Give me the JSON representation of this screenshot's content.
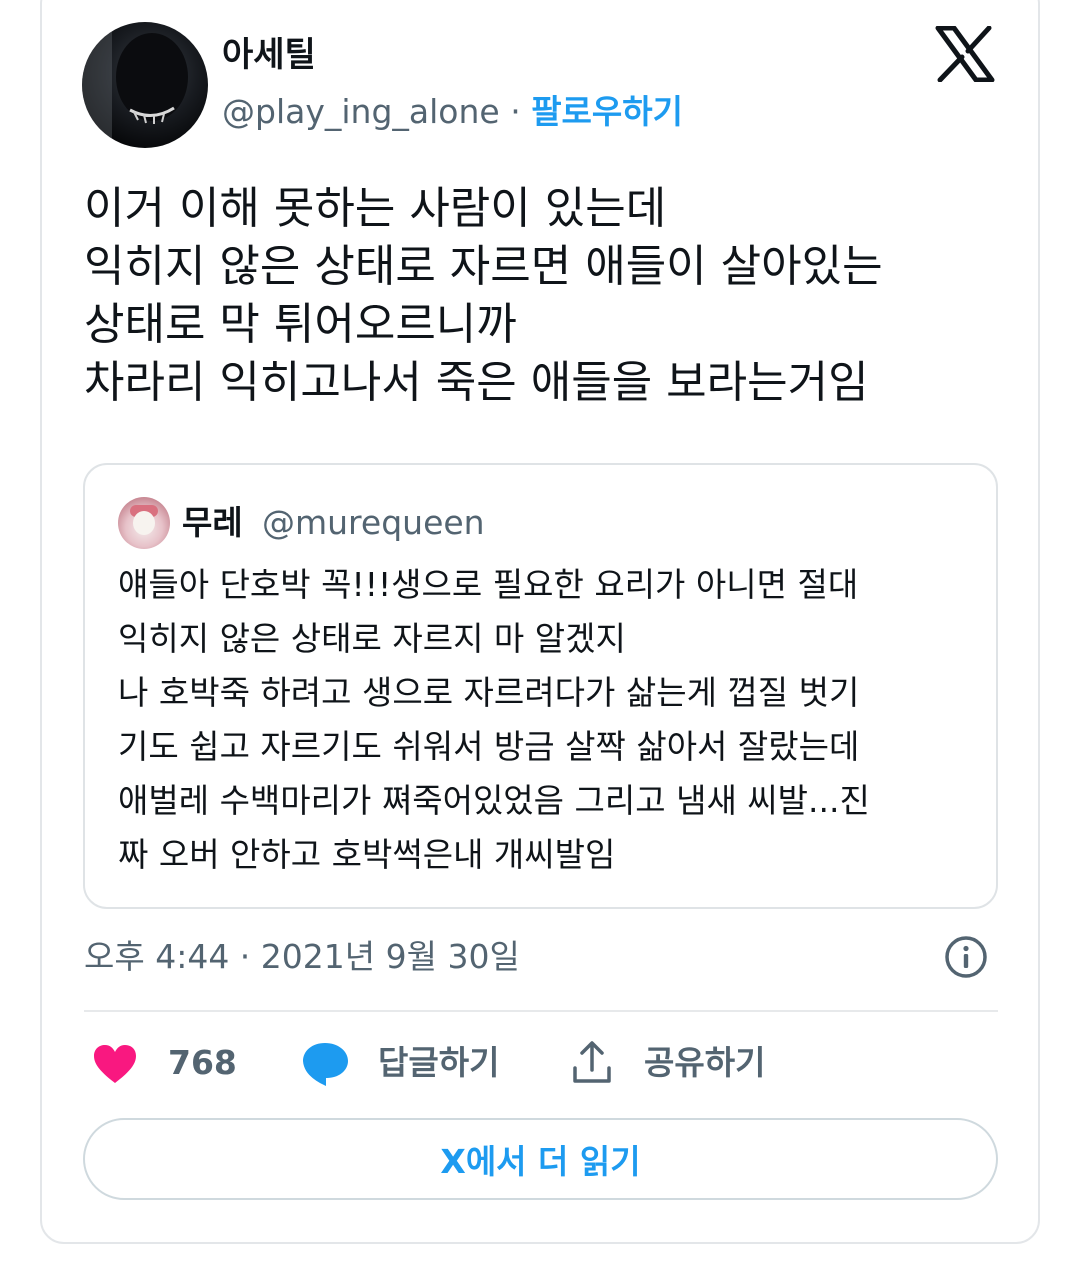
{
  "tweet": {
    "author_name": "아세틸",
    "author_handle": "@play_ing_alone",
    "separator": " · ",
    "follow_label": "팔로우하기",
    "text": "이거 이해 못하는 사람이 있는데\n익히지 않은 상태로 자르면 애들이 살아있는\n상태로 막 튀어오르니까\n차라리 익히고나서 죽은 애들을 보라는거임",
    "timestamp": "오후 4:44 · 2021년 9월 30일"
  },
  "quoted_tweet": {
    "author_name": "무레",
    "author_handle": "@murequeen",
    "text": "얘들아 단호박 꼭!!!생으로 필요한 요리가 아니면 절대\n익히지 않은 상태로 자르지 마 알겠지\n나 호박죽 하려고 생으로 자르려다가 삶는게 껍질 벗기\n기도 쉽고 자르기도 쉬워서 방금 살짝 삶아서 잘랐는데\n애벌레 수백마리가 쪄죽어있었음 그리고 냄새 씨발...진\n짜 오버 안하고 호박썩은내 개씨발임"
  },
  "actions": {
    "like_count": "768",
    "reply_label": "답글하기",
    "share_label": "공유하기",
    "read_more_label": "X에서 더 읽기"
  },
  "colors": {
    "accent": "#1d9bf0",
    "like": "#f91880",
    "muted": "#536471",
    "text": "#0f1419"
  },
  "icons": [
    "x-logo-icon",
    "info-icon",
    "heart-icon",
    "speech-bubble-icon",
    "share-upload-icon"
  ]
}
